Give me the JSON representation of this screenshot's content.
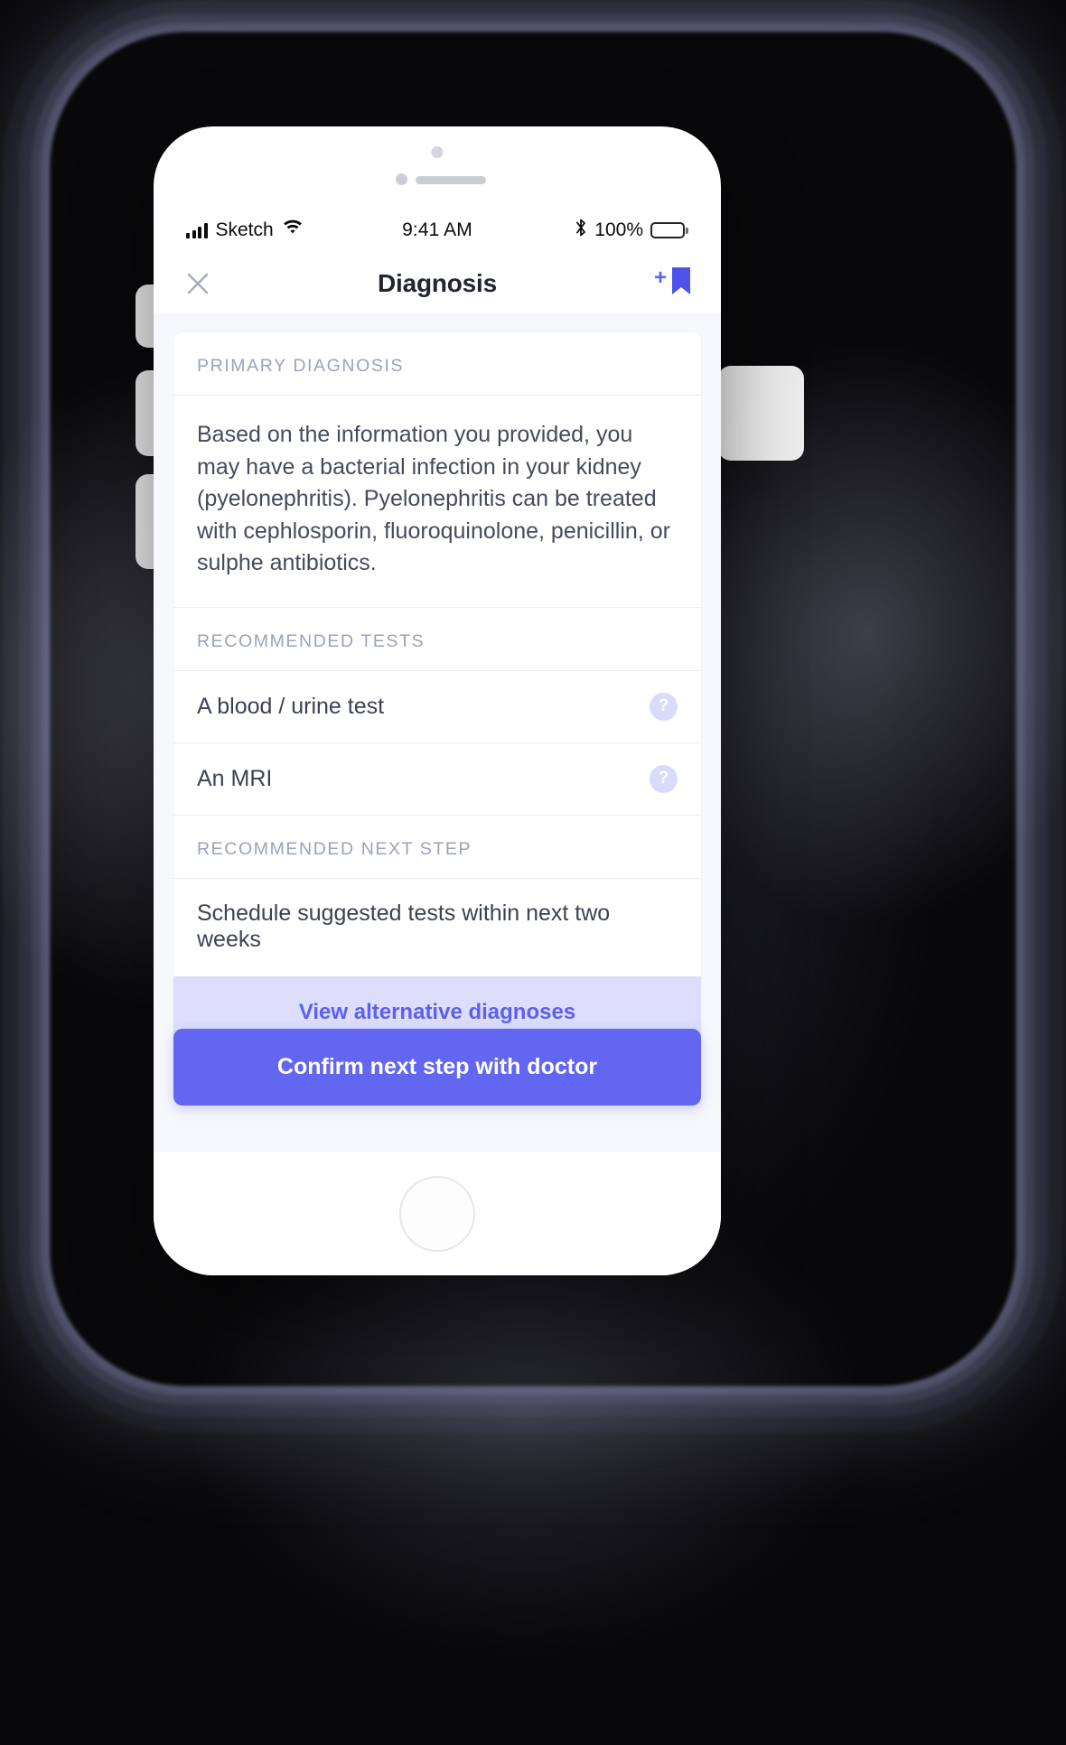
{
  "status_bar": {
    "carrier": "Sketch",
    "signal_icon": "signal-bars-icon",
    "wifi_icon": "wifi-icon",
    "time": "9:41 AM",
    "bluetooth_icon": "bluetooth-icon",
    "battery_percent": "100%",
    "battery_icon": "battery-full-icon"
  },
  "nav": {
    "close_icon": "close-icon",
    "title": "Diagnosis",
    "bookmark_icon": "bookmark-icon",
    "add_glyph": "+"
  },
  "sections": {
    "primary_diagnosis_label": "PRIMARY DIAGNOSIS",
    "primary_diagnosis_text": "Based on the information you provided, you may have a bacterial infection in your kidney (pyelonephritis). Pyelonephritis can be treated with cephlosporin, fluoroquinolone, penicillin, or sulphe antibiotics.",
    "recommended_tests_label": "RECOMMENDED TESTS",
    "tests": [
      {
        "label": "A blood / urine test",
        "help_glyph": "?"
      },
      {
        "label": "An MRI",
        "help_glyph": "?"
      }
    ],
    "next_step_label": "RECOMMENDED NEXT STEP",
    "next_step_text": "Schedule suggested tests within next two weeks"
  },
  "actions": {
    "secondary_label": "View alternative diagnoses",
    "primary_label": "Confirm next step with doctor"
  },
  "colors": {
    "accent": "#6366f1",
    "secondary_button_bg": "#dcdefb",
    "secondary_button_text": "#5d60ef",
    "screen_bg": "#f7f8fc",
    "muted_label": "#9ba2bb"
  }
}
